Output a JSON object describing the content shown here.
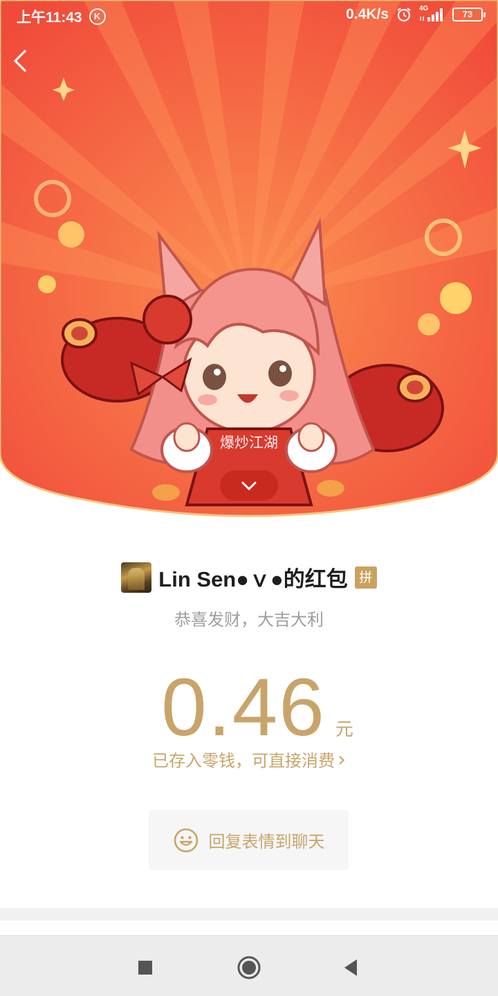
{
  "status_bar": {
    "time": "上午11:43",
    "k_badge": "K",
    "net_speed": "0.4K/s",
    "network_type": "4G",
    "battery": "73",
    "icons": [
      "alarm-icon",
      "signal-icon",
      "battery-icon"
    ]
  },
  "header": {
    "channel_label": "爆炒江湖",
    "icons": [
      "back-icon",
      "chevron-down-icon"
    ],
    "colors": {
      "red": "#f2553f",
      "orange_ray": "#f77a4a",
      "gold_border": "#f3c47d"
    }
  },
  "packet": {
    "sender_name": "Lin Sen●ｖ●的红包",
    "pin_badge": "拼",
    "blessing": "恭喜发财，大吉大利",
    "amount": "0.46",
    "unit": "元",
    "saved_link": "已存入零钱，可直接消费",
    "saved_link_chevron": "›",
    "reply_label": "回复表情到聊天",
    "colors": {
      "gold": "#c9a46a",
      "gray_text": "#9e9e9e"
    }
  },
  "nav_bar": {
    "buttons": [
      "recent-apps-button",
      "home-button",
      "back-nav-button"
    ]
  }
}
